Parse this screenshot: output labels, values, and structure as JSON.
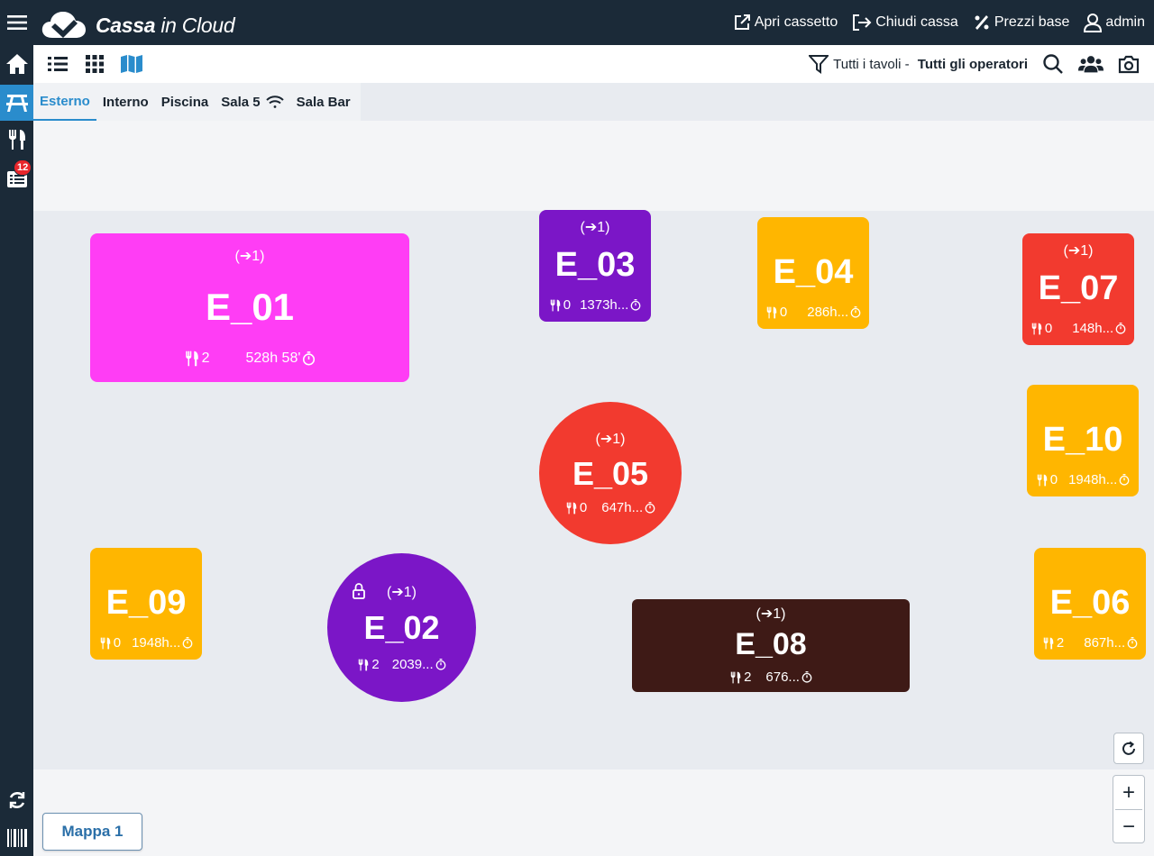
{
  "app": {
    "brand_bold": "Cassa",
    "brand_light": " in Cloud"
  },
  "top_actions": [
    {
      "label": "Apri cassetto",
      "icon": "external-open-icon"
    },
    {
      "label": "Chiudi cassa",
      "icon": "logout-icon"
    },
    {
      "label": "Prezzi base",
      "icon": "percent-icon"
    },
    {
      "label": "admin",
      "icon": "user-icon"
    }
  ],
  "sidebar": {
    "notifications_count": "12"
  },
  "toolbar": {
    "filter_prefix": "Tutti i tavoli - ",
    "filter_bold": "Tutti gli operatori"
  },
  "tabs": [
    {
      "label": "Esterno",
      "active": true
    },
    {
      "label": "Interno",
      "active": false
    },
    {
      "label": "Piscina",
      "active": false
    },
    {
      "label": "Sala 5",
      "active": false,
      "wifi": true
    },
    {
      "label": "Sala Bar",
      "active": false
    }
  ],
  "tables": [
    {
      "name": "E_01",
      "indicator": "(➔1)",
      "covers": "2",
      "time": "528h 58'",
      "color": "#ff3df5",
      "shape": "rect",
      "locked": false
    },
    {
      "name": "E_03",
      "indicator": "(➔1)",
      "covers": "0",
      "time": "1373h...",
      "color": "#7b16c7",
      "shape": "rect",
      "locked": false
    },
    {
      "name": "E_04",
      "indicator": "",
      "covers": "0",
      "time": "286h...",
      "color": "#ffb600",
      "shape": "rect",
      "locked": false
    },
    {
      "name": "E_07",
      "indicator": "(➔1)",
      "covers": "0",
      "time": "148h...",
      "color": "#f23a2f",
      "shape": "rect",
      "locked": false
    },
    {
      "name": "E_05",
      "indicator": "(➔1)",
      "covers": "0",
      "time": "647h...",
      "color": "#f23a2f",
      "shape": "round",
      "locked": false
    },
    {
      "name": "E_10",
      "indicator": "",
      "covers": "0",
      "time": "1948h...",
      "color": "#ffb600",
      "shape": "rect",
      "locked": false
    },
    {
      "name": "E_09",
      "indicator": "",
      "covers": "0",
      "time": "1948h...",
      "color": "#ffb600",
      "shape": "rect",
      "locked": false
    },
    {
      "name": "E_02",
      "indicator": "(➔1)",
      "covers": "2",
      "time": "2039...",
      "color": "#7b16c7",
      "shape": "round",
      "locked": true
    },
    {
      "name": "E_08",
      "indicator": "(➔1)",
      "covers": "2",
      "time": "676...",
      "color": "#3e1a16",
      "shape": "rect",
      "locked": false
    },
    {
      "name": "E_06",
      "indicator": "",
      "covers": "2",
      "time": "867h...",
      "color": "#ffb600",
      "shape": "rect",
      "locked": false
    }
  ],
  "map_selector": {
    "label": "Mappa 1"
  },
  "zoom": {
    "plus": "+",
    "minus": "−"
  }
}
